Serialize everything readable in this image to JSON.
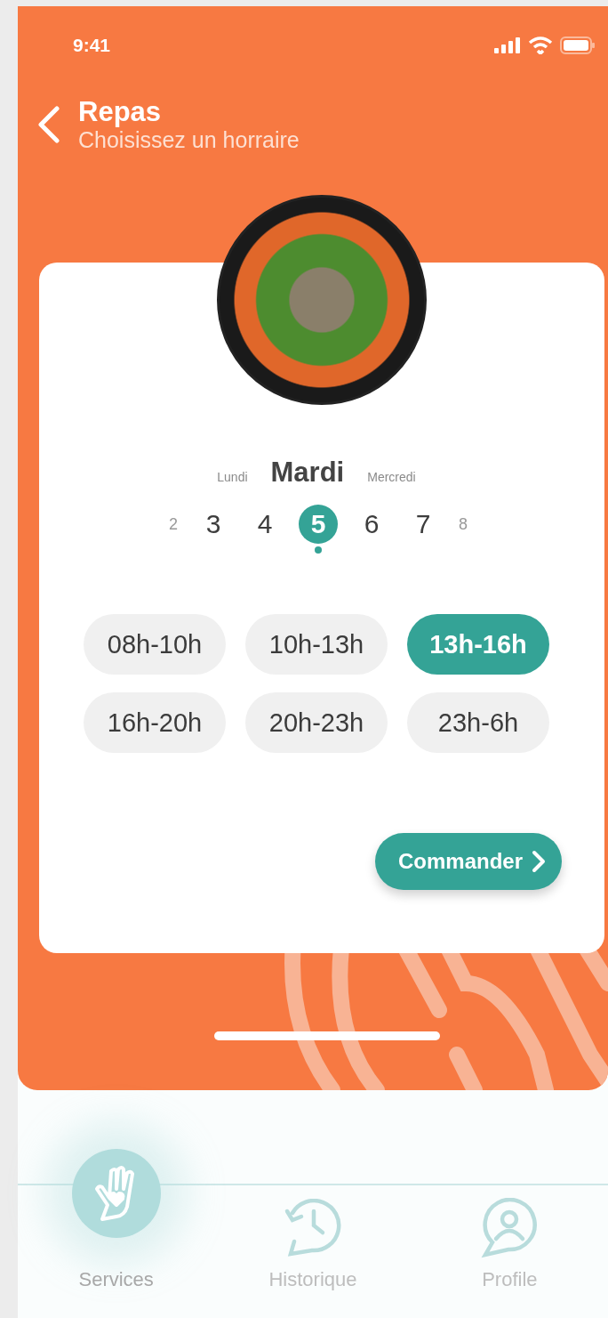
{
  "status_bar": {
    "time": "9:41"
  },
  "header": {
    "title": "Repas",
    "subtitle": "Choisissez un horraire"
  },
  "day_names": [
    {
      "label": "Lundi",
      "selected": false
    },
    {
      "label": "Mardi",
      "selected": true
    },
    {
      "label": "Mercredi",
      "selected": false
    }
  ],
  "dates": [
    {
      "label": "2",
      "kind": "edge",
      "selected": false
    },
    {
      "label": "3",
      "kind": "normal",
      "selected": false
    },
    {
      "label": "4",
      "kind": "normal",
      "selected": false
    },
    {
      "label": "5",
      "kind": "normal",
      "selected": true
    },
    {
      "label": "6",
      "kind": "normal",
      "selected": false
    },
    {
      "label": "7",
      "kind": "normal",
      "selected": false
    },
    {
      "label": "8",
      "kind": "edge",
      "selected": false
    }
  ],
  "time_slots": [
    {
      "label": "08h-10h",
      "selected": false
    },
    {
      "label": "10h-13h",
      "selected": false
    },
    {
      "label": "13h-16h",
      "selected": true
    },
    {
      "label": "16h-20h",
      "selected": false
    },
    {
      "label": "20h-23h",
      "selected": false
    },
    {
      "label": "23h-6h",
      "selected": false
    }
  ],
  "order_button": {
    "label": "Commander"
  },
  "bottom_nav": [
    {
      "label": "Services",
      "kind": "services",
      "selected": true
    },
    {
      "label": "Historique",
      "kind": "history",
      "selected": false
    },
    {
      "label": "Profile",
      "kind": "profile",
      "selected": false
    }
  ]
}
